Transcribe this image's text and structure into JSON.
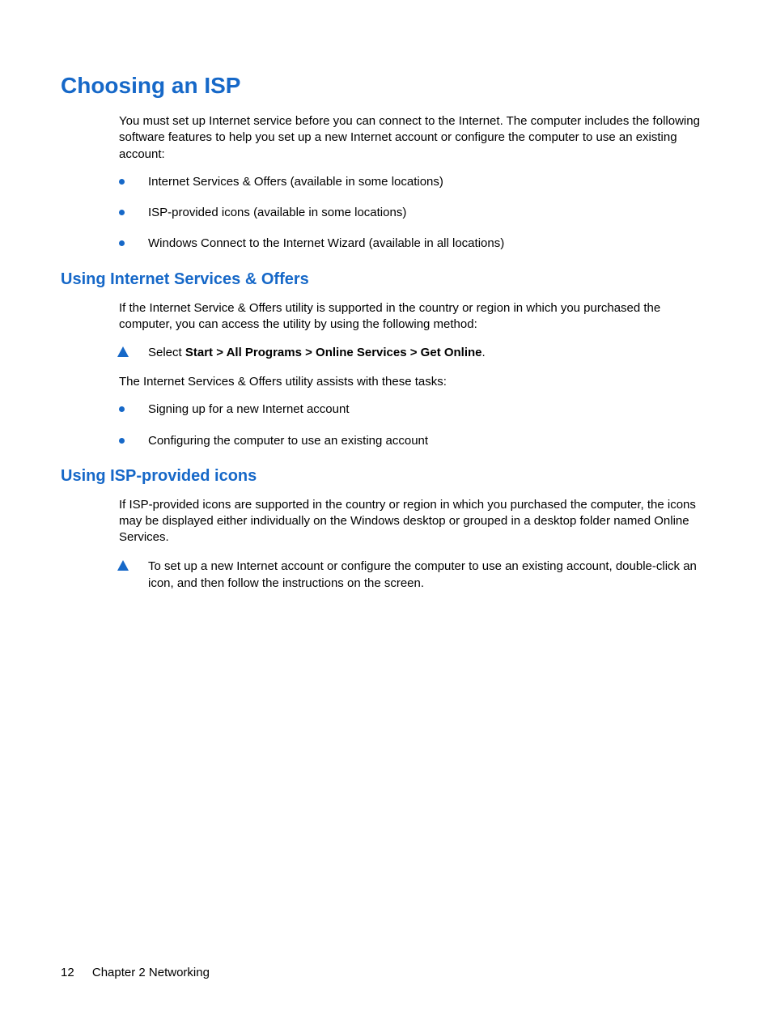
{
  "h1": "Choosing an ISP",
  "intro": "You must set up Internet service before you can connect to the Internet. The computer includes the following software features to help you set up a new Internet account or configure the computer to use an existing account:",
  "features": [
    "Internet Services & Offers (available in some locations)",
    "ISP-provided icons (available in some locations)",
    "Windows Connect to the Internet Wizard (available in all locations)"
  ],
  "section1": {
    "title": "Using Internet Services & Offers",
    "intro": "If the Internet Service & Offers utility is supported in the country or region in which you purchased the computer, you can access the utility by using the following method:",
    "step_prefix": "Select ",
    "step_bold": "Start > All Programs > Online Services > Get Online",
    "step_suffix": ".",
    "assist": "The Internet Services & Offers utility assists with these tasks:",
    "tasks": [
      "Signing up for a new Internet account",
      "Configuring the computer to use an existing account"
    ]
  },
  "section2": {
    "title": "Using ISP-provided icons",
    "intro": "If ISP-provided icons are supported in the country or region in which you purchased the computer, the icons may be displayed either individually on the Windows desktop or grouped in a desktop folder named Online Services.",
    "step": "To set up a new Internet account or configure the computer to use an existing account, double-click an icon, and then follow the instructions on the screen."
  },
  "footer": {
    "page": "12",
    "chapter": "Chapter 2   Networking"
  }
}
